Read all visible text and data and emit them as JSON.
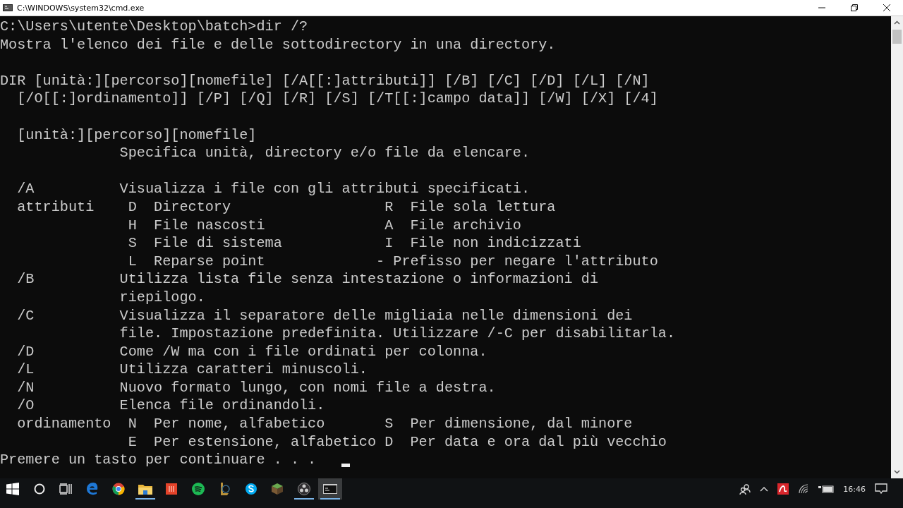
{
  "window": {
    "title": "C:\\WINDOWS\\system32\\cmd.exe"
  },
  "console": {
    "blocks": [
      [
        "C:\\Users\\utente\\Desktop\\batch>dir /?",
        "Mostra l'elenco dei file e delle sottodirectory in una directory."
      ],
      [
        "DIR [unità:][percorso][nomefile] [/A[[:]attributi]] [/B] [/C] [/D] [/L] [/N]",
        "  [/O[[:]ordinamento]] [/P] [/Q] [/R] [/S] [/T[[:]campo data]] [/W] [/X] [/4]"
      ],
      [
        "  [unità:][percorso][nomefile]",
        "              Specifica unità, directory e/o file da elencare."
      ],
      [
        "  /A          Visualizza i file con gli attributi specificati.",
        "  attributi    D  Directory                  R  File sola lettura",
        "               H  File nascosti              A  File archivio",
        "               S  File di sistema            I  File non indicizzati",
        "               L  Reparse point             - Prefisso per negare l'attributo",
        "  /B          Utilizza lista file senza intestazione o informazioni di",
        "              riepilogo.",
        "  /C          Visualizza il separatore delle migliaia nelle dimensioni dei",
        "              file. Impostazione predefinita. Utilizzare /-C per disabilitarla.",
        "  /D          Come /W ma con i file ordinati per colonna.",
        "  /L          Utilizza caratteri minuscoli.",
        "  /N          Nuovo formato lungo, con nomi file a destra.",
        "  /O          Elenca file ordinandoli.",
        "  ordinamento  N  Per nome, alfabetico       S  Per dimensione, dal minore",
        "               E  Per estensione, alfabetico D  Per data e ora dal più vecchio",
        "Premere un tasto per continuare . . . "
      ]
    ]
  },
  "taskbar": {
    "apps": [
      {
        "kind": "start",
        "running": false,
        "selected": false
      },
      {
        "kind": "search",
        "running": false,
        "selected": false
      },
      {
        "kind": "taskview",
        "running": false,
        "selected": false
      },
      {
        "kind": "edge",
        "running": false,
        "selected": false
      },
      {
        "kind": "chrome",
        "running": false,
        "selected": false
      },
      {
        "kind": "folder",
        "running": true,
        "selected": false
      },
      {
        "kind": "redapp",
        "running": false,
        "selected": false
      },
      {
        "kind": "spotify",
        "running": false,
        "selected": false
      },
      {
        "kind": "game",
        "running": false,
        "selected": false
      },
      {
        "kind": "skype",
        "running": false,
        "selected": false
      },
      {
        "kind": "cube",
        "running": false,
        "selected": false
      },
      {
        "kind": "obs",
        "running": true,
        "selected": false
      },
      {
        "kind": "terminal",
        "running": true,
        "selected": true
      }
    ],
    "clock": "16:46"
  }
}
